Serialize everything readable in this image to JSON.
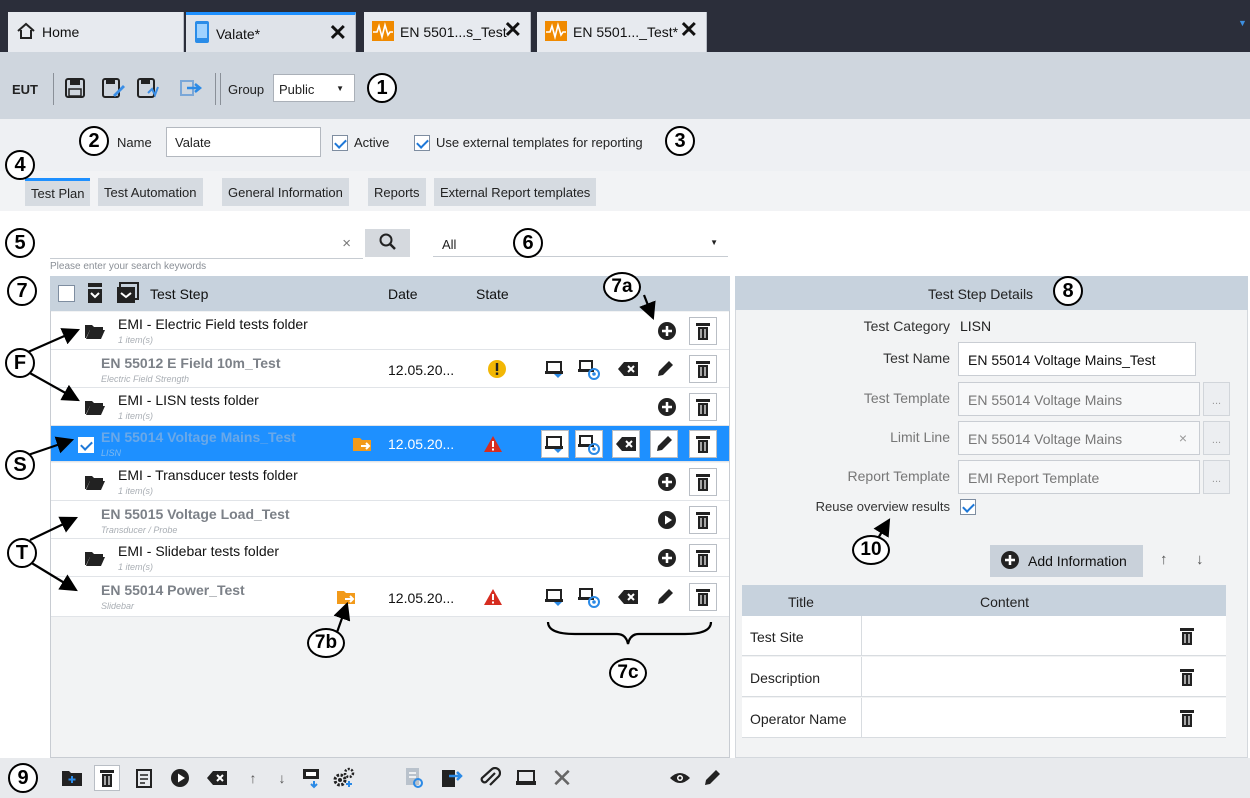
{
  "tabs": [
    {
      "label": "Home",
      "icon": "home-icon"
    },
    {
      "label": "Valate*",
      "icon": "device-icon"
    },
    {
      "label": "EN 5501...s_Test",
      "icon": "waveform-icon"
    },
    {
      "label": "EN 5501..._Test*",
      "icon": "waveform-icon"
    }
  ],
  "toolbar": {
    "eut_label": "EUT",
    "group_label": "Group",
    "group_value": "Public"
  },
  "form": {
    "name_label": "Name",
    "name_value": "Valate",
    "active_label": "Active",
    "external_label": "Use external templates for reporting"
  },
  "section_tabs": [
    "Test Plan",
    "Test Automation",
    "General Information",
    "Reports",
    "External Report templates"
  ],
  "search": {
    "hint": "Please enter your search keywords",
    "filter_value": "All"
  },
  "tree": {
    "headers": {
      "step": "Test Step",
      "date": "Date",
      "state": "State"
    },
    "rows": [
      {
        "kind": "folder",
        "title": "EMI - Electric Field tests folder",
        "sub": "1 item(s)"
      },
      {
        "kind": "step",
        "title": "EN 55012 E Field 10m_Test",
        "sub": "Electric Field Strength",
        "date": "12.05.20..."
      },
      {
        "kind": "folder",
        "title": "EMI - LISN tests folder",
        "sub": "1 item(s)"
      },
      {
        "kind": "step",
        "title": "EN 55014 Voltage Mains_Test",
        "sub": "LISN",
        "date": "12.05.20..."
      },
      {
        "kind": "folder",
        "title": "EMI - Transducer tests folder",
        "sub": "1 item(s)"
      },
      {
        "kind": "step",
        "title": "EN 55015 Voltage Load_Test",
        "sub": "Transducer / Probe"
      },
      {
        "kind": "folder",
        "title": "EMI - Slidebar tests folder",
        "sub": "1 item(s)"
      },
      {
        "kind": "step",
        "title": "EN 55014 Power_Test",
        "sub": "Slidebar",
        "date": "12.05.20..."
      }
    ]
  },
  "details": {
    "title": "Test Step Details",
    "category_label": "Test Category",
    "category_value": "LISN",
    "name_label": "Test Name",
    "name_value": "EN 55014 Voltage Mains_Test",
    "template_label": "Test Template",
    "template_value": "EN 55014 Voltage Mains",
    "limit_label": "Limit Line",
    "limit_value": "EN 55014 Voltage Mains",
    "report_label": "Report Template",
    "report_value": "EMI Report Template",
    "reuse_label": "Reuse overview results",
    "dots": "...",
    "add_info": "Add Information",
    "info_headers": {
      "title": "Title",
      "content": "Content"
    },
    "info_rows": [
      "Test Site",
      "Description",
      "Operator Name"
    ]
  },
  "callouts": [
    "1",
    "2",
    "3",
    "4",
    "5",
    "6",
    "7",
    "7a",
    "8",
    "F",
    "S",
    "T",
    "10",
    "7b",
    "7c",
    "9"
  ],
  "colors": {
    "accent": "#1e90ff",
    "warning": "#f2b705",
    "error": "#d62d20",
    "header": "#c7d2dd"
  }
}
